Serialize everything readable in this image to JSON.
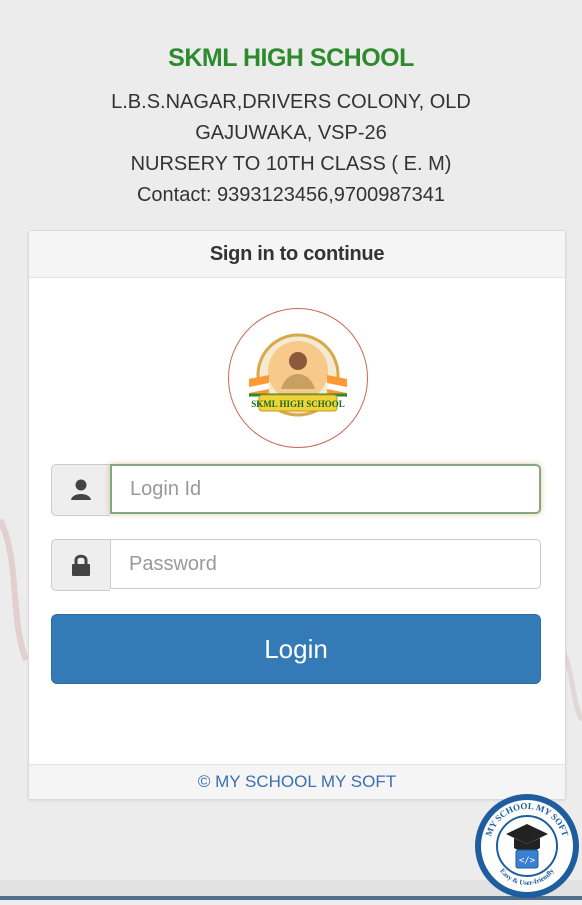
{
  "header": {
    "school_name": "SKML HIGH SCHOOL",
    "address_line1": "L.B.S.NAGAR,DRIVERS COLONY, OLD",
    "address_line2": "GAJUWAKA, VSP-26",
    "classes": "NURSERY TO 10TH CLASS ( E. M)",
    "contact": "Contact: 9393123456,9700987341"
  },
  "panel": {
    "heading": "Sign in to continue",
    "logo_text": "SKML HIGH SCHOOL",
    "login_id": {
      "value": "",
      "placeholder": "Login Id",
      "icon": "user-icon"
    },
    "password": {
      "value": "",
      "placeholder": "Password",
      "icon": "lock-icon"
    },
    "login_button": "Login",
    "footer": "© MY SCHOOL MY SOFT"
  },
  "badge": {
    "top_text": "MY SCHOOL MY SOFT",
    "bottom_text": "Easy & User-friendly"
  },
  "colors": {
    "school_name": "#2d8a2d",
    "button": "#337ab7",
    "footer_text": "#3a6fb0",
    "badge": "#1f5e9e"
  }
}
